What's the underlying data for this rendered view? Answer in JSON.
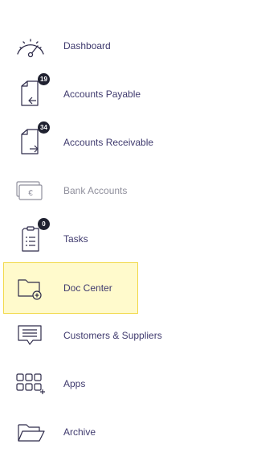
{
  "sidebar": {
    "items": [
      {
        "label": "Dashboard",
        "icon": "gauge-icon"
      },
      {
        "label": "Accounts Payable",
        "icon": "document-arrow-left-icon",
        "badge": "19"
      },
      {
        "label": "Accounts Receivable",
        "icon": "document-arrow-right-icon",
        "badge": "34"
      },
      {
        "label": "Bank Accounts",
        "icon": "euro-cards-icon",
        "muted": true
      },
      {
        "label": "Tasks",
        "icon": "checklist-icon",
        "badge": "0"
      },
      {
        "label": "Doc Center",
        "icon": "folder-add-icon",
        "active": true
      },
      {
        "label": "Customers & Suppliers",
        "icon": "chat-list-icon"
      },
      {
        "label": "Apps",
        "icon": "apps-grid-icon"
      },
      {
        "label": "Archive",
        "icon": "open-folder-icon"
      }
    ]
  },
  "colors": {
    "label": "#3f3a6e",
    "muted_label": "#8f8f9c",
    "active_bg": "#fffacc",
    "active_border": "#f2d94a",
    "badge_bg": "#1f2130"
  }
}
